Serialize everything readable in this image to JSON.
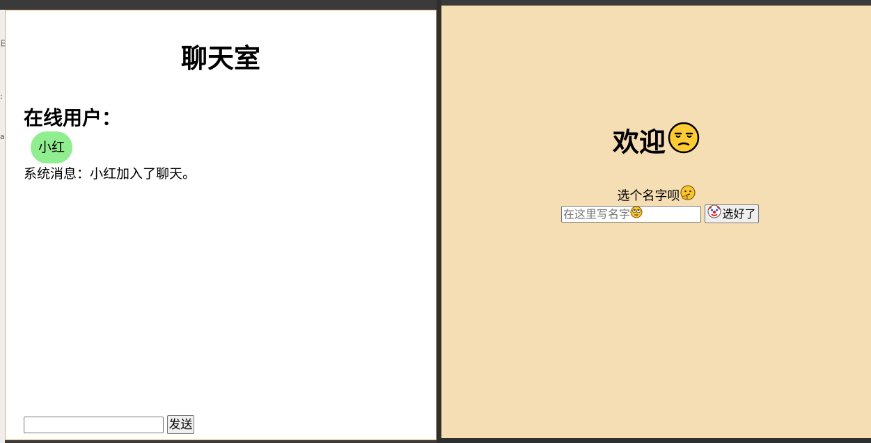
{
  "chat_room": {
    "title": "聊天室",
    "online_heading": "在线用户：",
    "online_users": [
      "小红"
    ],
    "system_message": "系统消息：小红加入了聊天。",
    "message_input_value": "",
    "send_label": "发送",
    "border_color": "#e8a860",
    "user_pill_color": "#90ee90"
  },
  "welcome": {
    "heading": "欢迎",
    "heading_icon": "unamused-face-icon",
    "prompt": "选个名字呗",
    "prompt_icon": "thinking-face-icon",
    "name_placeholder": "在这里写名字",
    "placeholder_icon": "rolling-eyes-face-icon",
    "choose_label": "选好了",
    "choose_icon": "clown-face-icon",
    "background_color": "#f5deb3"
  }
}
